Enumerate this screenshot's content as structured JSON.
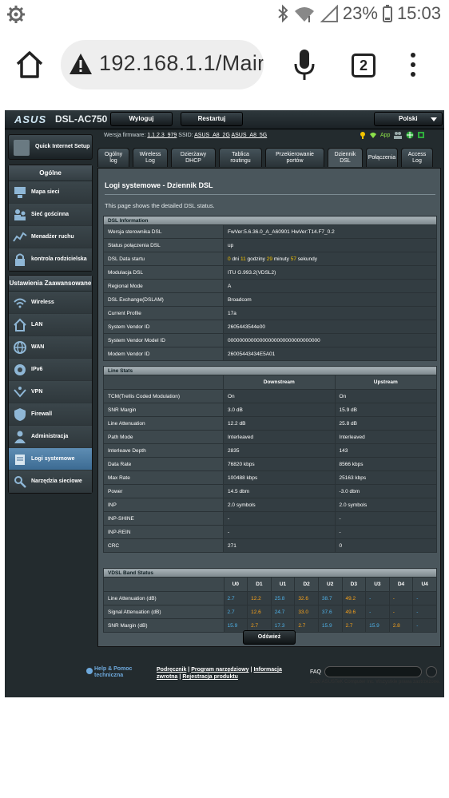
{
  "status_bar": {
    "battery": "23%",
    "time": "15:03"
  },
  "browser": {
    "url": "192.168.1.1/Mair",
    "tab_count": "2"
  },
  "router": {
    "brand": "ASUS",
    "model": "DSL-AC750",
    "logout": "Wyloguj",
    "restart": "Restartuj",
    "language": "Polski",
    "firmware_label": "Wersja firmware:",
    "firmware_version": "1.1.2.3_979",
    "ssid_label": "SSID:",
    "ssid1": "ASUS_A8_2G",
    "ssid2": "ASUS_A8_5G",
    "app_label": "App"
  },
  "sidebar": {
    "quick": "Quick Internet Setup",
    "general_title": "Ogólne",
    "general": [
      "Mapa sieci",
      "Sieć gościnna",
      "Menadżer ruchu",
      "kontrola rodzicielska"
    ],
    "advanced_title": "Ustawienia Zaawansowane",
    "advanced": [
      "Wireless",
      "LAN",
      "WAN",
      "IPv6",
      "VPN",
      "Firewall",
      "Administracja",
      "Logi systemowe",
      "Narzędzia sieciowe"
    ]
  },
  "tabs": [
    {
      "l1": "Ogólny",
      "l2": "log"
    },
    {
      "l1": "Wireless",
      "l2": "Log"
    },
    {
      "l1": "Dzierżawy",
      "l2": "DHCP"
    },
    {
      "l1": "Tablica",
      "l2": "routingu"
    },
    {
      "l1": "Przekierowanie",
      "l2": "portów"
    },
    {
      "l1": "Dziennik",
      "l2": "DSL"
    },
    {
      "l1": "Połączenia",
      "l2": ""
    },
    {
      "l1": "Access",
      "l2": "Log"
    }
  ],
  "content": {
    "title": "Logi systemowe - Dziennik DSL",
    "desc": "This page shows the detailed DSL status.",
    "dsl_info_title": "DSL Information",
    "dsl_info": [
      {
        "k": "Wersja sterownika DSL",
        "v": "FwVer:5.6.36.0_A_A60901 HwVer:T14.F7_0.2"
      },
      {
        "k": "Status połączenia DSL",
        "v": "up"
      },
      {
        "k": "DSL Data startu",
        "v": ""
      },
      {
        "k": "Modulacja DSL",
        "v": "ITU G.993.2(VDSL2)"
      },
      {
        "k": "Regional Mode",
        "v": "A"
      },
      {
        "k": "DSL Exchange(DSLAM)",
        "v": "Broadcom"
      },
      {
        "k": "Current Profile",
        "v": "17a"
      },
      {
        "k": "System Vendor ID",
        "v": "2605443544e00"
      },
      {
        "k": "System Vendor Model ID",
        "v": "00000000000000000000000000000000"
      },
      {
        "k": "Modem Vendor ID",
        "v": "26005443434E5A01"
      }
    ],
    "uptime": {
      "d": "0",
      "d_l": "dni",
      "h": "11",
      "h_l": "godziny",
      "m": "29",
      "m_l": "minuty",
      "s": "57",
      "s_l": "sekundy"
    },
    "line_stats_title": "Line Stats",
    "ls_head": {
      "down": "Downstream",
      "up": "Upstream"
    },
    "line_stats": [
      {
        "k": "TCM(Trellis Coded Modulation)",
        "d": "On",
        "u": "On"
      },
      {
        "k": "SNR Margin",
        "d": "3.0 dB",
        "u": "15.9 dB"
      },
      {
        "k": "Line Attenuation",
        "d": "12.2 dB",
        "u": "25.8 dB"
      },
      {
        "k": "Path Mode",
        "d": "Interleaved",
        "u": "Interleaved"
      },
      {
        "k": "Interleave Depth",
        "d": "2835",
        "u": "143"
      },
      {
        "k": "Data Rate",
        "d": "76820 kbps",
        "u": "8566 kbps"
      },
      {
        "k": "Max Rate",
        "d": "100488 kbps",
        "u": "25163 kbps"
      },
      {
        "k": "Power",
        "d": "14.5 dbm",
        "u": "-3.0 dbm"
      },
      {
        "k": "INP",
        "d": "2.0 symbols",
        "u": "2.0 symbols"
      },
      {
        "k": "INP-SHINE",
        "d": "-",
        "u": "-"
      },
      {
        "k": "INP-REIN",
        "d": "-",
        "u": "-"
      },
      {
        "k": "CRC",
        "d": "271",
        "u": "0"
      }
    ],
    "band_title": "VDSL Band Status",
    "band_cols": [
      "U0",
      "D1",
      "U1",
      "D2",
      "U2",
      "D3",
      "U3",
      "D4",
      "U4"
    ],
    "band_rows": [
      {
        "k": "Line Attenuation (dB)",
        "v": [
          "2.7",
          "12.2",
          "25.8",
          "32.6",
          "38.7",
          "49.2",
          "-",
          "-",
          "-"
        ]
      },
      {
        "k": "Signal Attenuation (dB)",
        "v": [
          "2.7",
          "12.6",
          "24.7",
          "33.0",
          "37.6",
          "49.6",
          "-",
          "-",
          "-"
        ]
      },
      {
        "k": "SNR Margin (dB)",
        "v": [
          "15.9",
          "2.7",
          "17.3",
          "2.7",
          "15.9",
          "2.7",
          "15.9",
          "2.8",
          "-"
        ]
      }
    ],
    "refresh": "Odśwież"
  },
  "footer": {
    "help1": "Help & Pomoc",
    "help2": "techniczna",
    "l1": "Podręcznik",
    "sep1": " | ",
    "l2": "Program narzędziowy",
    "sep2": " | ",
    "l3": "Informacja",
    "l4": "zwrotna",
    "sep3": " | ",
    "l5": "Rejestracja produktu",
    "faq": "FAQ",
    "copyright": "2020 ASUSTeK Computer Inc. Wszystkie prawa zastrzeżone."
  },
  "colors": {
    "up_color": "#4fb1e7",
    "down_color": "#f7a21b",
    "highlight": "#f5c400"
  }
}
